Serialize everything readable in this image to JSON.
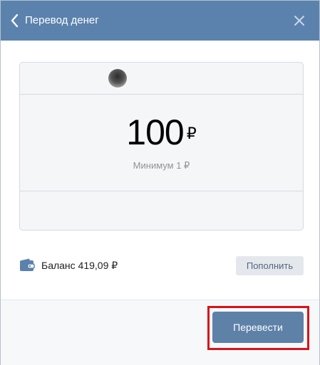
{
  "header": {
    "title": "Перевод денег",
    "back_icon": "chevron-left-icon",
    "close_icon": "close-icon"
  },
  "card": {
    "amount": "100",
    "currency": "₽",
    "minimum": "Минимум 1 ₽"
  },
  "balance": {
    "icon": "wallet-icon",
    "text": "Баланс 419,09 ₽",
    "topup_label": "Пополнить"
  },
  "footer": {
    "send_label": "Перевести"
  },
  "colors": {
    "header_bg": "#5b82ad",
    "send_button_bg": "#5e81a8",
    "highlight_border": "#d6141b"
  }
}
